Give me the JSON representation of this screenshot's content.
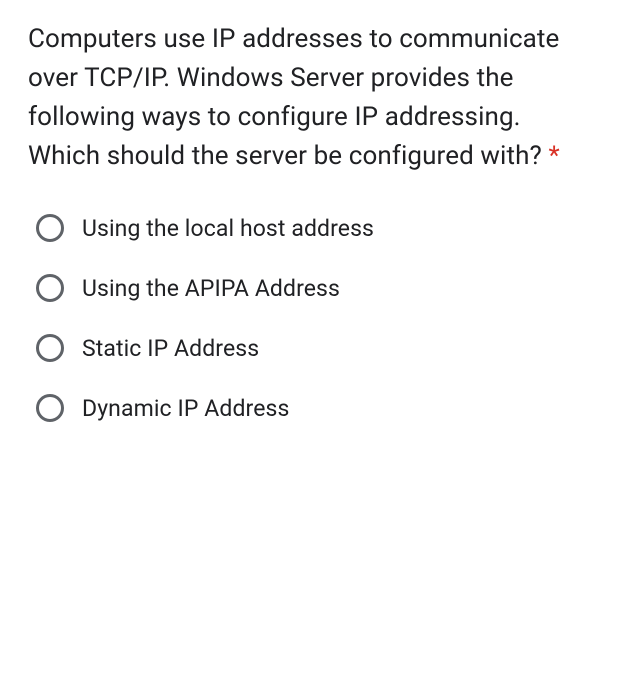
{
  "question": {
    "text": "Computers use IP addresses to communicate over TCP/IP. Windows Server provides the following ways to configure IP addressing. Which should the server be configured with?",
    "required_marker": "*"
  },
  "options": [
    {
      "label": "Using the local host address"
    },
    {
      "label": "Using the APIPA Address"
    },
    {
      "label": "Static IP Address"
    },
    {
      "label": "Dynamic IP Address"
    }
  ]
}
